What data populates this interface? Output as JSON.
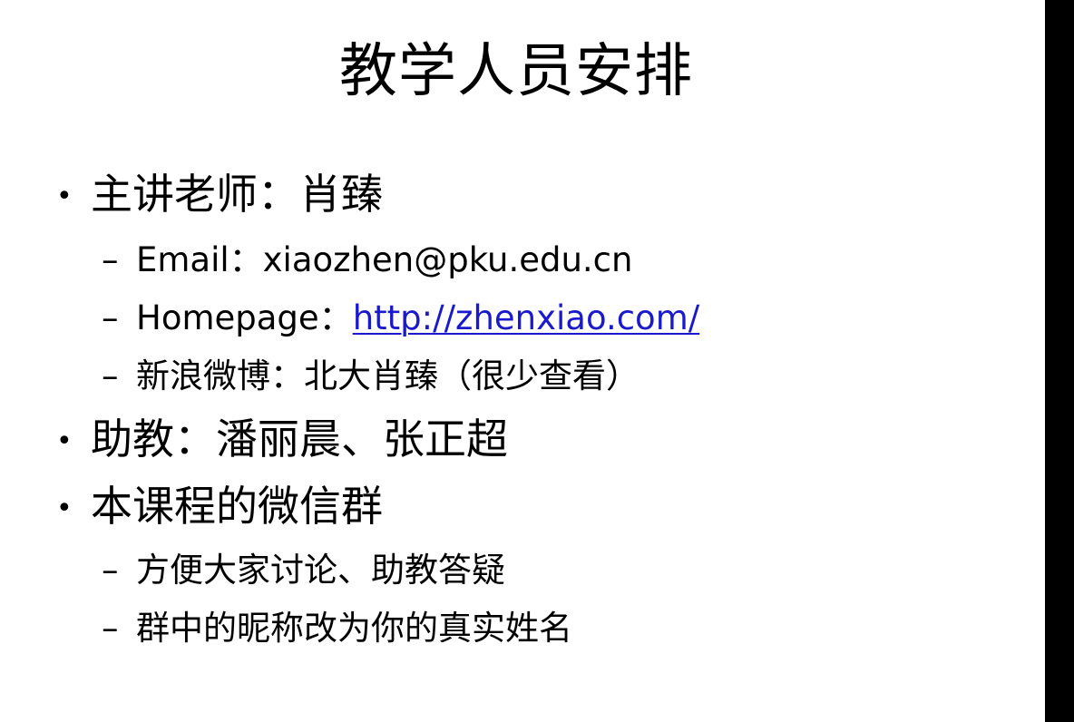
{
  "slide": {
    "title": "教学人员安排",
    "bullets": [
      {
        "marker": "•",
        "text": "主讲老师：肖臻",
        "subitems": [
          {
            "marker": "–",
            "label": "Email：",
            "value": "xiaozhen@pku.edu.cn"
          },
          {
            "marker": "–",
            "label": "Homepage：",
            "link": "http://zhenxiao.com/"
          },
          {
            "marker": "–",
            "label": "新浪微博：",
            "value": "北大肖臻（很少查看）"
          }
        ]
      },
      {
        "marker": "•",
        "text": "助教：潘丽晨、张正超",
        "subitems": []
      },
      {
        "marker": "•",
        "text": "本课程的微信群",
        "subitems": [
          {
            "marker": "–",
            "text": "方便大家讨论、助教答疑"
          },
          {
            "marker": "–",
            "text": "群中的昵称改为你的真实姓名"
          }
        ]
      }
    ]
  },
  "colors": {
    "background": "#ffffff",
    "text": "#000000",
    "link": "#1a1acc",
    "side_bar": "#000000"
  }
}
